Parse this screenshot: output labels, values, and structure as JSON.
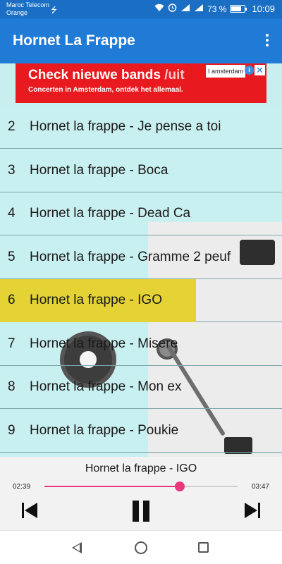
{
  "status_bar": {
    "carrier_line1": "Maroc Telecom",
    "carrier_line2": "Orange",
    "battery_percent": "73 %",
    "battery_level": 0.73,
    "time": "10:09",
    "icons": [
      "usb-icon",
      "wifi-icon",
      "alarm-icon",
      "signal-3g-icon",
      "signal-icon",
      "battery-icon"
    ]
  },
  "app_bar": {
    "title": "Hornet La Frappe",
    "overflow_icon": "more-vert-icon"
  },
  "ad": {
    "headline": "Check nieuwe bands ",
    "headline_accent": "/uit",
    "subline": "Concerten in Amsterdam, ontdek het allemaal.",
    "brand": "I amsterdam",
    "info_glyph": "i",
    "close_glyph": "✕",
    "colors": {
      "background": "#e8191f"
    }
  },
  "tracks": [
    {
      "number": "2",
      "title": "Hornet la frappe -  Je pense a toi",
      "active": false
    },
    {
      "number": "3",
      "title": "Hornet la frappe - Boca",
      "active": false
    },
    {
      "number": "4",
      "title": "Hornet la frappe - Dead Ca",
      "active": false
    },
    {
      "number": "5",
      "title": "Hornet la frappe - Gramme 2 peuf",
      "active": false
    },
    {
      "number": "6",
      "title": "Hornet la frappe - IGO",
      "active": true
    },
    {
      "number": "7",
      "title": "Hornet la frappe - Misere",
      "active": false
    },
    {
      "number": "8",
      "title": "Hornet la frappe - Mon ex",
      "active": false
    },
    {
      "number": "9",
      "title": "Hornet la frappe - Poukie",
      "active": false
    }
  ],
  "player": {
    "now_playing": "Hornet la frappe - IGO",
    "elapsed": "02:39",
    "total": "03:47",
    "progress": 0.7,
    "controls": [
      "skip-previous-icon",
      "pause-icon",
      "skip-next-icon"
    ],
    "colors": {
      "accent": "#e8397a"
    }
  },
  "nav_bar": {
    "icons": [
      "back-icon",
      "home-icon",
      "recents-icon"
    ]
  },
  "colors": {
    "status_bar": "#1a6fc4",
    "app_bar": "#1f7bd6",
    "list_background": "#c9f0f1",
    "active_row": "#e5d235"
  }
}
